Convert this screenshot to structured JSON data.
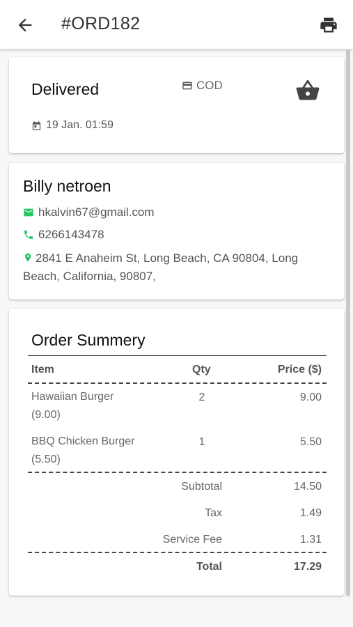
{
  "header": {
    "title": "#ORD182",
    "back_icon": "arrow-left-icon",
    "print_icon": "printer-icon"
  },
  "order": {
    "status": "Delivered",
    "payment": "COD",
    "payment_icon": "credit-card-icon",
    "date": "19 Jan. 01:59",
    "date_icon": "calendar-icon",
    "basket_icon": "basket-icon"
  },
  "customer": {
    "name": "Billy netroen",
    "email": "hkalvin67@gmail.com",
    "phone": "6266143478",
    "address": "2841 E Anaheim St, Long Beach, CA 90804, Long Beach, California, 90807,",
    "icon_color": "#22c55e"
  },
  "summary": {
    "title": "Order Summery",
    "headers": {
      "item": "Item",
      "qty": "Qty",
      "price": "Price ($)"
    },
    "items": [
      {
        "name": "Hawaiian Burger",
        "unit": "(9.00)",
        "qty": "2",
        "price": "9.00"
      },
      {
        "name": "BBQ Chicken Burger",
        "unit": "(5.50)",
        "qty": "1",
        "price": "5.50"
      }
    ],
    "subtotal_label": "Subtotal",
    "subtotal": "14.50",
    "tax_label": "Tax",
    "tax": "1.49",
    "fee_label": "Service Fee",
    "fee": "1.31",
    "total_label": "Total",
    "total": "17.29"
  }
}
